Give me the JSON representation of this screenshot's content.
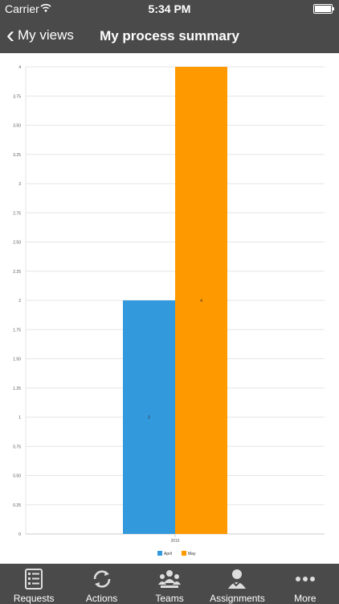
{
  "status_bar": {
    "carrier": "Carrier",
    "time": "5:34 PM"
  },
  "nav": {
    "back_label": "My views",
    "title": "My process summary"
  },
  "tabs": [
    {
      "label": "Requests",
      "icon": "requests-icon"
    },
    {
      "label": "Actions",
      "icon": "actions-icon"
    },
    {
      "label": "Teams",
      "icon": "teams-icon"
    },
    {
      "label": "Assignments",
      "icon": "assignments-icon"
    },
    {
      "label": "More",
      "icon": "more-icon"
    }
  ],
  "colors": {
    "bar_bg": "#4a4a4a",
    "april": "#3399dd",
    "may": "#ff9900"
  },
  "chart_data": {
    "type": "bar",
    "categories": [
      "2015"
    ],
    "series": [
      {
        "name": "April",
        "values": [
          2
        ]
      },
      {
        "name": "May",
        "values": [
          4
        ]
      }
    ],
    "data_labels": [
      "2",
      "4"
    ],
    "y_ticks": [
      "0",
      "0.25",
      "0.50",
      "0.75",
      "1",
      "1.25",
      "1.50",
      "1.75",
      "2",
      "2.25",
      "2.50",
      "2.75",
      "3",
      "3.25",
      "3.50",
      "3.75",
      "4"
    ],
    "ylim": [
      0,
      4
    ],
    "grid": true,
    "legend": "bottom-center"
  }
}
